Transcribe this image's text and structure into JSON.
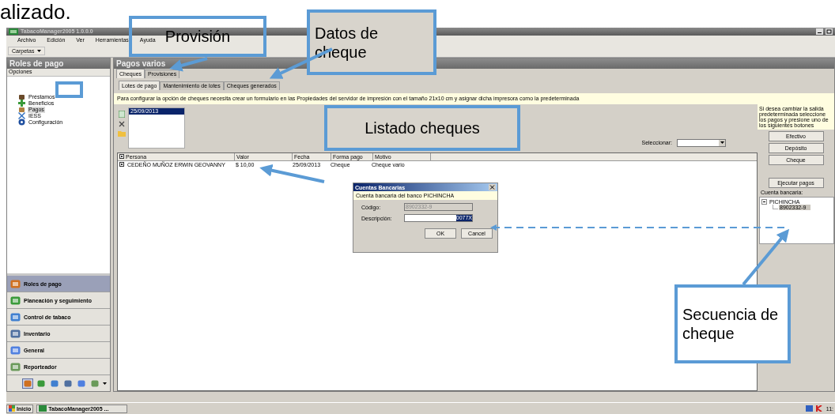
{
  "document_text": "alizado.",
  "window": {
    "title": "TabacoManager2005 1.0.0.0"
  },
  "menu": [
    "Archivo",
    "Edición",
    "Ver",
    "Herramientas",
    "Ayuda"
  ],
  "toolbar": {
    "label": "Carpetas"
  },
  "sidebar": {
    "title": "Roles de pago",
    "section": "Opciones",
    "items": [
      {
        "label": "Préstamos",
        "kind": "money",
        "selected": false
      },
      {
        "label": "Beneficios",
        "kind": "plus",
        "selected": false
      },
      {
        "label": "Pagos",
        "kind": "bag",
        "selected": true
      },
      {
        "label": "IESS",
        "kind": "cross",
        "selected": false
      },
      {
        "label": "Configuración",
        "kind": "gear",
        "selected": false
      }
    ],
    "modules": [
      {
        "label": "Roles de pago",
        "kind": "people",
        "selected": true
      },
      {
        "label": "Planeación y seguimiento",
        "kind": "list",
        "selected": false
      },
      {
        "label": "Control de tabaco",
        "kind": "chart",
        "selected": false
      },
      {
        "label": "Inventario",
        "kind": "stack",
        "selected": false
      },
      {
        "label": "General",
        "kind": "ring",
        "selected": false
      },
      {
        "label": "Reporteador",
        "kind": "report",
        "selected": false
      }
    ],
    "module_icons": [
      {
        "kind": "people",
        "selected": true
      },
      {
        "kind": "list",
        "selected": false
      },
      {
        "kind": "chart",
        "selected": false
      },
      {
        "kind": "stack",
        "selected": false
      },
      {
        "kind": "ring",
        "selected": false
      },
      {
        "kind": "report",
        "selected": false
      }
    ]
  },
  "main": {
    "title": "Pagos varios",
    "tabs": [
      {
        "label": "Cheques",
        "selected": true
      },
      {
        "label": "Provisiones",
        "selected": false
      }
    ],
    "subtabs": [
      {
        "label": "Lotes de pago",
        "selected": true
      },
      {
        "label": "Mantenimiento de lotes",
        "selected": false
      },
      {
        "label": "Cheques generados",
        "selected": false
      }
    ],
    "notice": "Para configurar la opción de cheques necesita crear un formulario en las Propiedades del servidor de impresión con el tamaño 21x10 cm y asignar dicha impresora como la predeterminada",
    "batches": [
      {
        "label": "25/09/2013",
        "selected": true
      }
    ],
    "select_label": "Seleccionar:",
    "columns": [
      "Persona",
      "Valor",
      "Fecha",
      "Forma pago",
      "Motivo"
    ],
    "header_checked": true,
    "rows": [
      {
        "checked": true,
        "cells": [
          "CEDEÑO MUÑOZ ERWIN GEOVANNY",
          "$ 10,00",
          "25/09/2013",
          "Cheque",
          "Cheque vario"
        ]
      }
    ]
  },
  "side_panel": {
    "note": "Si desea cambiar la salida predeterminada seleccione los pagos y presione uno de los siguientes botones",
    "buttons": [
      "Efectivo",
      "Depósito",
      "Cheque"
    ],
    "run_button": "Ejecutar pagos",
    "account_label": "Cuenta bancaria:",
    "tree": [
      {
        "label": "PICHINCHA",
        "expanded": true,
        "selected": false,
        "children": [
          {
            "label": "8902332-9",
            "selected": true
          }
        ]
      }
    ]
  },
  "dialog": {
    "title": "Cuentas Bancarias",
    "notice": "Cuenta bancaria del banco PICHINCHA",
    "fields": [
      {
        "label": "Código:",
        "value": "8902332-9",
        "disabled": true,
        "value_selected": false
      },
      {
        "label": "Descripción:",
        "value": "0077X",
        "disabled": false,
        "value_selected": true
      }
    ],
    "buttons": [
      "OK",
      "Cancel"
    ]
  },
  "callouts": [
    {
      "text": "Provisión",
      "kind": "clear"
    },
    {
      "text": "Datos de cheque",
      "kind": "grey"
    },
    {
      "text": "Listado cheques",
      "kind": "grey"
    },
    {
      "text": "Secuencia de cheque",
      "kind": "white"
    },
    {
      "kind": "marker"
    }
  ],
  "taskbar": {
    "start": "Inicio",
    "tasks": [
      "TabacoManager2005 ..."
    ],
    "clock": "11:"
  }
}
